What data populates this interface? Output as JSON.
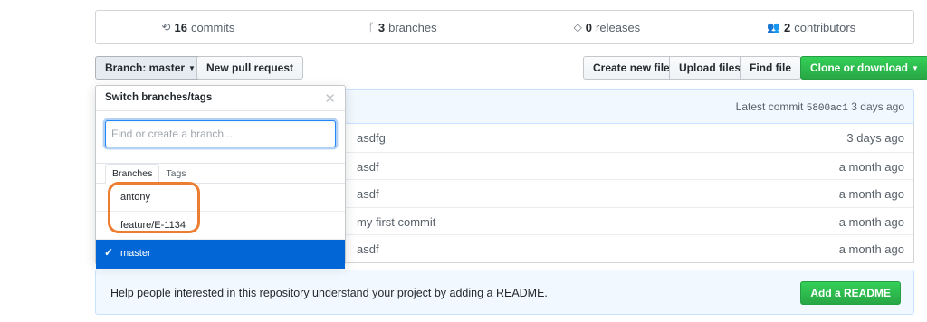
{
  "stats": {
    "commits": {
      "count": "16",
      "label": "commits",
      "icon": "history-icon"
    },
    "branches": {
      "count": "3",
      "label": "branches",
      "icon": "branch-icon"
    },
    "releases": {
      "count": "0",
      "label": "releases",
      "icon": "tag-icon"
    },
    "contributors": {
      "count": "2",
      "label": "contributors",
      "icon": "people-icon"
    }
  },
  "toolbar": {
    "branch_label": "Branch: master",
    "new_pr": "New pull request",
    "create_file": "Create new file",
    "upload_files": "Upload files",
    "find_file": "Find file",
    "clone": "Clone or download"
  },
  "commit_bar": {
    "prefix": "Latest commit",
    "sha": "5800ac1",
    "age": "3 days ago"
  },
  "files": [
    {
      "message": "asdfg",
      "age": "3 days ago"
    },
    {
      "message": "asdf",
      "age": "a month ago"
    },
    {
      "message": "asdf",
      "age": "a month ago"
    },
    {
      "message": "my first commit",
      "age": "a month ago"
    },
    {
      "message": "asdf",
      "age": "a month ago"
    }
  ],
  "dropdown": {
    "title": "Switch branches/tags",
    "placeholder": "Find or create a branch...",
    "tabs": [
      "Branches",
      "Tags"
    ],
    "branches": [
      "antony",
      "feature/E-1134",
      "master"
    ],
    "selected": "master"
  },
  "readme": {
    "text": "Help people interested in this repository understand your project by adding a README.",
    "button": "Add a README"
  },
  "colors": {
    "accent_blue": "#0366d6",
    "green": "#28a745",
    "annotation_orange": "#ed7d31"
  }
}
